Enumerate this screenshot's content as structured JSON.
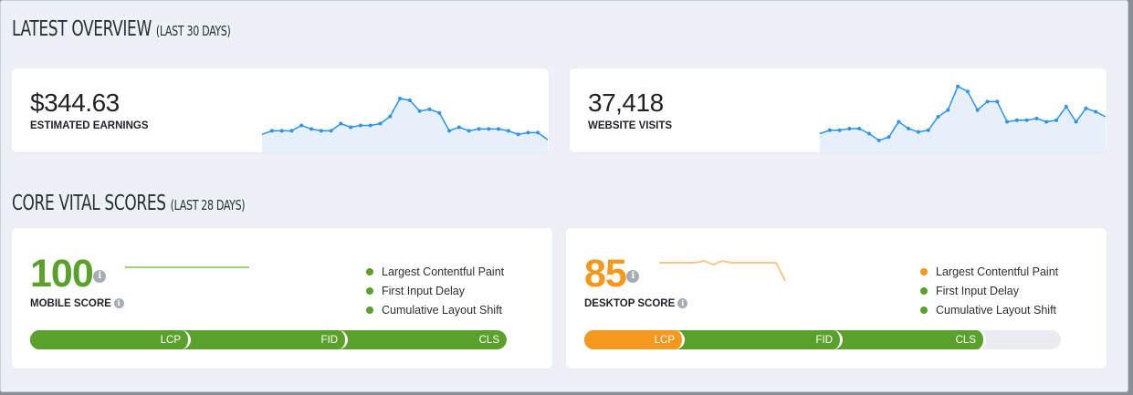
{
  "overview": {
    "title": "LATEST OVERVIEW",
    "period": "(LAST 30 DAYS)",
    "cards": [
      {
        "value": "$344.63",
        "label": "ESTIMATED EARNINGS",
        "spark": [
          9,
          11,
          11,
          11,
          14,
          12,
          11,
          11,
          15,
          13,
          14,
          14,
          15,
          19,
          29,
          28,
          22,
          23,
          21,
          11,
          13,
          11,
          12,
          12,
          12,
          11,
          9,
          10,
          10,
          6
        ]
      },
      {
        "value": "37,418",
        "label": "WEBSITE VISITS",
        "spark": [
          10,
          12,
          12,
          13,
          13,
          10,
          6,
          8,
          17,
          13,
          11,
          12,
          20,
          24,
          38,
          35,
          24,
          29,
          29,
          17,
          18,
          18,
          19,
          17,
          18,
          26,
          17,
          25,
          23,
          20
        ]
      }
    ]
  },
  "vitals": {
    "title": "CORE VITAL SCORES",
    "period": "(LAST 28 DAYS)",
    "info_glyph": "i",
    "cards": [
      {
        "score": "100",
        "score_color": "#5aa12b",
        "label": "MOBILE SCORE",
        "trend": [
          100,
          100,
          100,
          100,
          100,
          100,
          100,
          100,
          100,
          100,
          100,
          100,
          100,
          100
        ],
        "trend_color": "#9ed27d",
        "legend": [
          {
            "label": "Largest Contentful Paint",
            "color": "#5aa12b"
          },
          {
            "label": "First Input Delay",
            "color": "#5aa12b"
          },
          {
            "label": "Cumulative Layout Shift",
            "color": "#5aa12b"
          }
        ],
        "segments": [
          {
            "label": "LCP",
            "color": "#5aa12b",
            "end": 0.338
          },
          {
            "label": "FID",
            "color": "#5aa12b",
            "end": 0.667
          },
          {
            "label": "CLS",
            "color": "#5aa12b",
            "end": 1.0
          }
        ]
      },
      {
        "score": "85",
        "score_color": "#f6981e",
        "label": "DESKTOP SCORE",
        "trend": [
          90,
          90,
          90,
          90,
          90,
          91,
          89,
          91,
          90,
          90,
          90,
          90,
          90,
          90,
          80
        ],
        "trend_color": "#f8c78e",
        "legend": [
          {
            "label": "Largest Contentful Paint",
            "color": "#f6981e"
          },
          {
            "label": "First Input Delay",
            "color": "#5aa12b"
          },
          {
            "label": "Cumulative Layout Shift",
            "color": "#5aa12b"
          }
        ],
        "segments": [
          {
            "label": "LCP",
            "color": "#f6981e",
            "end": 0.21
          },
          {
            "label": "FID",
            "color": "#5aa12b",
            "end": 0.543
          },
          {
            "label": "CLS",
            "color": "#5aa12b",
            "end": 0.843
          }
        ]
      }
    ]
  },
  "colors": {
    "spark_line": "#2f93e6",
    "spark_fill": "#e5f0fb"
  }
}
